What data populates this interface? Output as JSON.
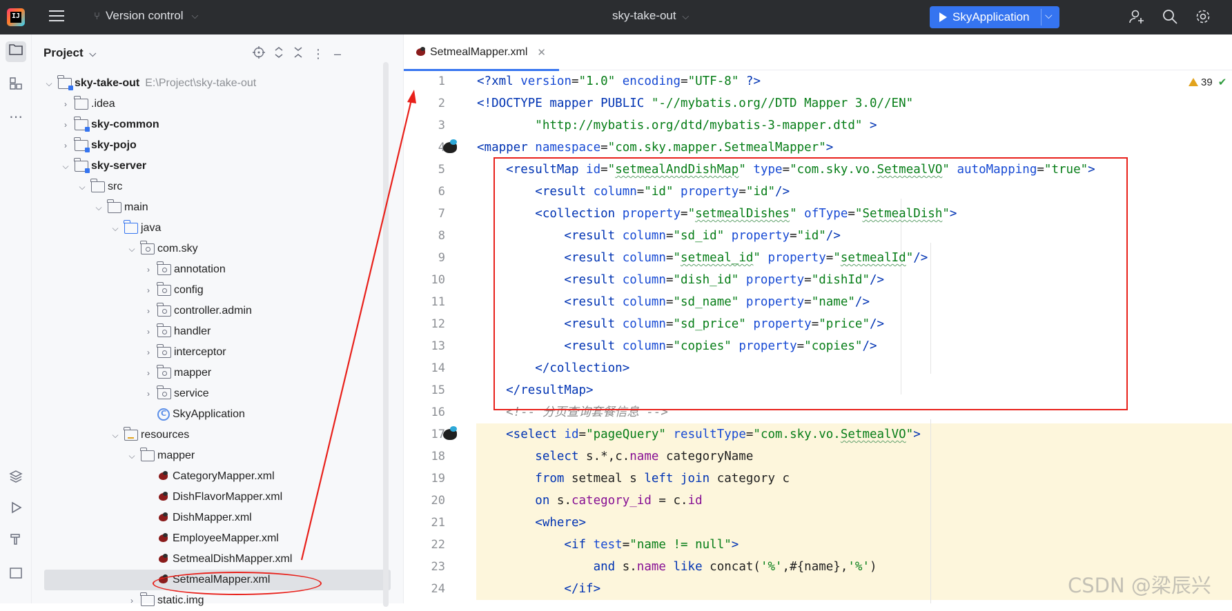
{
  "titlebar": {
    "version_control": "Version control",
    "project_name": "sky-take-out",
    "run_config": "SkyApplication"
  },
  "project_panel": {
    "title": "Project",
    "tree": [
      {
        "label": "sky-take-out",
        "path": "E:\\Project\\sky-take-out",
        "bold": true,
        "depth": 0,
        "arrow": "open",
        "icon": "module-folder-icon"
      },
      {
        "label": ".idea",
        "depth": 1,
        "arrow": "closed",
        "icon": "folder-icon"
      },
      {
        "label": "sky-common",
        "bold": true,
        "depth": 1,
        "arrow": "closed",
        "icon": "module-folder-icon"
      },
      {
        "label": "sky-pojo",
        "bold": true,
        "depth": 1,
        "arrow": "closed",
        "icon": "module-folder-icon"
      },
      {
        "label": "sky-server",
        "bold": true,
        "depth": 1,
        "arrow": "open",
        "icon": "module-folder-icon"
      },
      {
        "label": "src",
        "depth": 2,
        "arrow": "open",
        "icon": "folder-icon"
      },
      {
        "label": "main",
        "depth": 3,
        "arrow": "open",
        "icon": "folder-icon"
      },
      {
        "label": "java",
        "depth": 4,
        "arrow": "open",
        "icon": "source-folder-icon"
      },
      {
        "label": "com.sky",
        "depth": 5,
        "arrow": "open",
        "icon": "package-icon"
      },
      {
        "label": "annotation",
        "depth": 6,
        "arrow": "closed",
        "icon": "package-icon"
      },
      {
        "label": "config",
        "depth": 6,
        "arrow": "closed",
        "icon": "package-icon"
      },
      {
        "label": "controller.admin",
        "depth": 6,
        "arrow": "closed",
        "icon": "package-icon"
      },
      {
        "label": "handler",
        "depth": 6,
        "arrow": "closed",
        "icon": "package-icon"
      },
      {
        "label": "interceptor",
        "depth": 6,
        "arrow": "closed",
        "icon": "package-icon"
      },
      {
        "label": "mapper",
        "depth": 6,
        "arrow": "closed",
        "icon": "package-icon"
      },
      {
        "label": "service",
        "depth": 6,
        "arrow": "closed",
        "icon": "package-icon"
      },
      {
        "label": "SkyApplication",
        "depth": 6,
        "arrow": "none",
        "icon": "class-icon"
      },
      {
        "label": "resources",
        "depth": 4,
        "arrow": "open",
        "icon": "resources-folder-icon"
      },
      {
        "label": "mapper",
        "depth": 5,
        "arrow": "open",
        "icon": "folder-icon"
      },
      {
        "label": "CategoryMapper.xml",
        "depth": 6,
        "arrow": "none",
        "icon": "mybatis-xml-icon"
      },
      {
        "label": "DishFlavorMapper.xml",
        "depth": 6,
        "arrow": "none",
        "icon": "mybatis-xml-icon"
      },
      {
        "label": "DishMapper.xml",
        "depth": 6,
        "arrow": "none",
        "icon": "mybatis-xml-icon"
      },
      {
        "label": "EmployeeMapper.xml",
        "depth": 6,
        "arrow": "none",
        "icon": "mybatis-xml-icon"
      },
      {
        "label": "SetmealDishMapper.xml",
        "depth": 6,
        "arrow": "none",
        "icon": "mybatis-xml-icon"
      },
      {
        "label": "SetmealMapper.xml",
        "depth": 6,
        "arrow": "none",
        "icon": "mybatis-xml-icon",
        "selected": true
      },
      {
        "label": "static.img",
        "depth": 5,
        "arrow": "closed",
        "icon": "folder-icon"
      }
    ]
  },
  "editor": {
    "tab_label": "SetmealMapper.xml",
    "problems_count": "39",
    "line_numbers": [
      "1",
      "2",
      "3",
      "4",
      "5",
      "6",
      "7",
      "8",
      "9",
      "10",
      "11",
      "12",
      "13",
      "14",
      "15",
      "16",
      "17",
      "18",
      "19",
      "20",
      "21",
      "22",
      "23",
      "24"
    ]
  },
  "watermark": "CSDN @梁辰兴",
  "colors": {
    "accent": "#3574f0",
    "annotation_red": "#e8201a",
    "tag": "#0033b3",
    "string": "#067d17"
  }
}
